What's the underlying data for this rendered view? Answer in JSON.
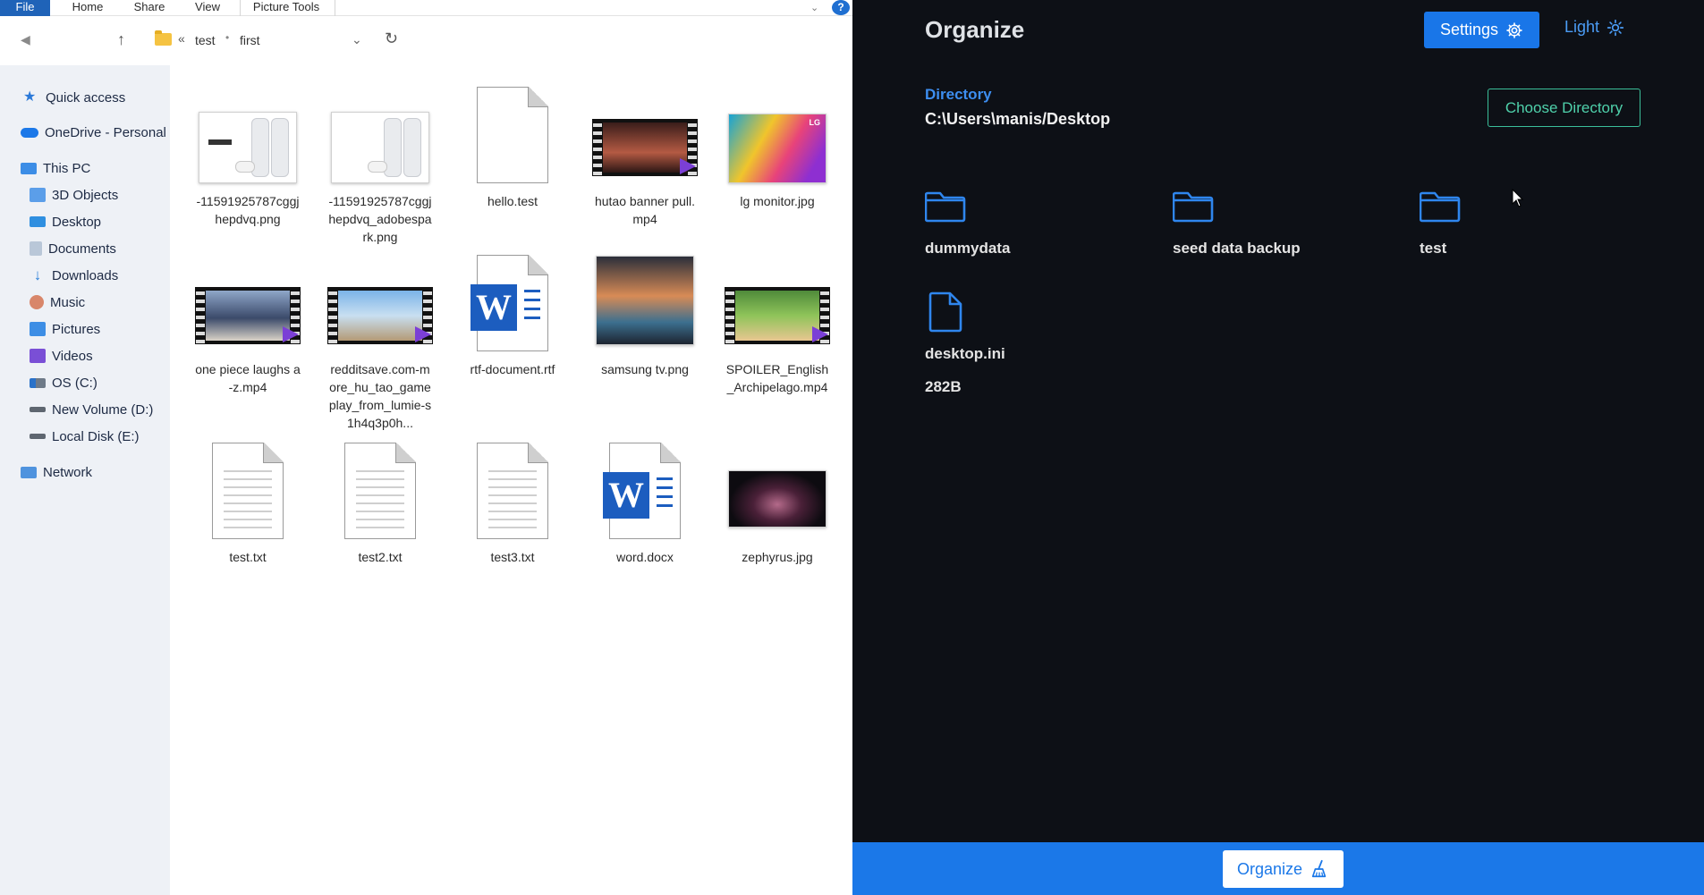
{
  "explorer": {
    "ribbon": {
      "file": "File",
      "home": "Home",
      "share": "Share",
      "view": "View",
      "picture_tools": "Picture Tools",
      "help": "?"
    },
    "address": {
      "chevrons": "«",
      "crumb1": "test",
      "crumb2": "first"
    },
    "sidebar": {
      "quick_access": "Quick access",
      "onedrive": "OneDrive - Personal",
      "this_pc": "This PC",
      "objects3d": "3D Objects",
      "desktop": "Desktop",
      "documents": "Documents",
      "downloads": "Downloads",
      "music": "Music",
      "pictures": "Pictures",
      "videos": "Videos",
      "os_c": "OS (C:)",
      "new_volume": "New Volume (D:)",
      "local_disk": "Local Disk (E:)",
      "network": "Network"
    },
    "files": [
      {
        "name": "-11591925787cggjhepdvq.png",
        "type": "image-ps5"
      },
      {
        "name": "-11591925787cggjhepdvq_adobespark.png",
        "type": "image-ps5"
      },
      {
        "name": "hello.test",
        "type": "blank"
      },
      {
        "name": "hutao banner pull.mp4",
        "type": "video"
      },
      {
        "name": "lg monitor.jpg",
        "type": "image-lg",
        "badge": "LG"
      },
      {
        "name": "one piece laughs a-z.mp4",
        "type": "video"
      },
      {
        "name": "redditsave.com-more_hu_tao_gameplay_from_lumie-s1h4q3p0h...",
        "type": "video"
      },
      {
        "name": "rtf-document.rtf",
        "type": "word"
      },
      {
        "name": "samsung tv.png",
        "type": "image-tv"
      },
      {
        "name": "SPOILER_English_Archipelago.mp4",
        "type": "video"
      },
      {
        "name": "test.txt",
        "type": "text"
      },
      {
        "name": "test2.txt",
        "type": "text"
      },
      {
        "name": "test3.txt",
        "type": "text"
      },
      {
        "name": "word.docx",
        "type": "word"
      },
      {
        "name": "zephyrus.jpg",
        "type": "image-laptop"
      }
    ]
  },
  "app": {
    "title": "Organize",
    "settings_label": "Settings",
    "theme_label": "Light",
    "directory_label": "Directory",
    "directory_path": "C:\\Users\\manis/Desktop",
    "choose_label": "Choose Directory",
    "entries": [
      {
        "name": "dummydata",
        "kind": "folder"
      },
      {
        "name": "seed data backup",
        "kind": "folder"
      },
      {
        "name": "test",
        "kind": "folder"
      },
      {
        "name": "desktop.ini",
        "kind": "file",
        "size": "282B"
      }
    ],
    "organize_label": "Organize",
    "accent": "#1b78e8"
  }
}
